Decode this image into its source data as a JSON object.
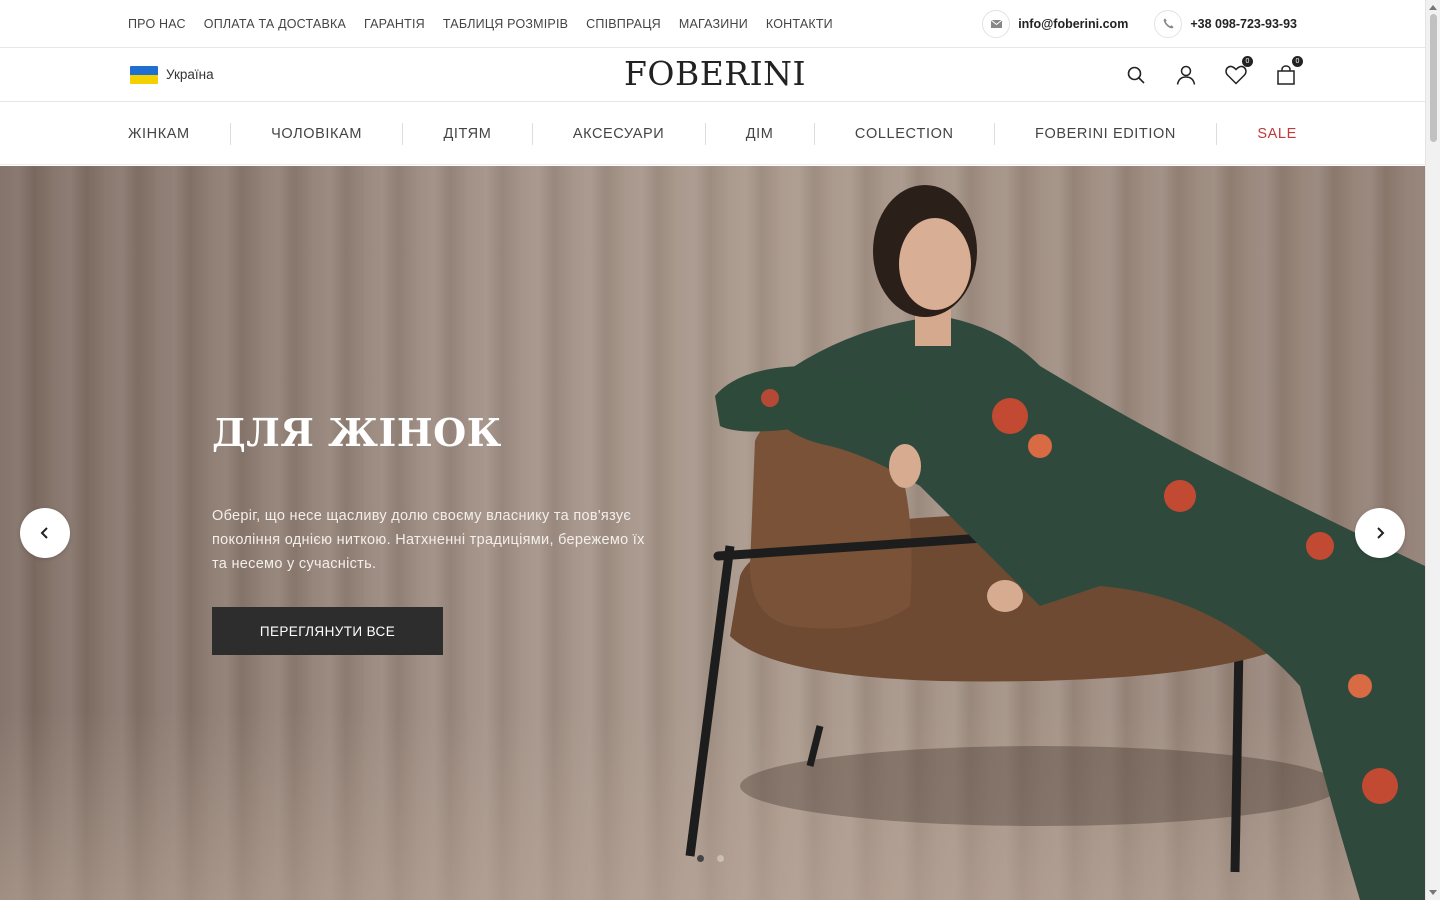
{
  "topnav": {
    "links": [
      "ПРО НАС",
      "ОПЛАТА ТА ДОСТАВКА",
      "ГАРАНТІЯ",
      "ТАБЛИЦЯ РОЗМІРІВ",
      "СПІВПРАЦЯ",
      "МАГАЗИНИ",
      "КОНТАКТИ"
    ]
  },
  "contacts": {
    "email": "info@foberini.com",
    "phone": "+38 098-723-93-93",
    "email_icon": "mail-icon",
    "phone_icon": "phone-icon"
  },
  "header": {
    "country": "Україна",
    "logo": "FOBERINI",
    "wishlist_count": "0",
    "cart_count": "0",
    "icons": [
      "search-icon",
      "user-icon",
      "heart-icon",
      "bag-icon"
    ]
  },
  "mainnav": {
    "items": [
      "ЖІНКАМ",
      "ЧОЛОВІКАМ",
      "ДІТЯМ",
      "АКСЕСУАРИ",
      "ДІМ",
      "COLLECTION",
      "FOBERINI EDITION",
      "SALE"
    ]
  },
  "hero": {
    "title": "ДЛЯ ЖІНОК",
    "text": "Оберіг, що несе щасливу долю своєму власнику та пов'язує покоління однією ниткою. Натхненні традиціями, бережемо їх та несемо у сучасність.",
    "button": "ПЕРЕГЛЯНУТИ ВСЕ",
    "slides_total": 2,
    "active_slide": 1
  },
  "colors": {
    "sale": "#c0393b",
    "button_bg": "#2d2d2d"
  }
}
